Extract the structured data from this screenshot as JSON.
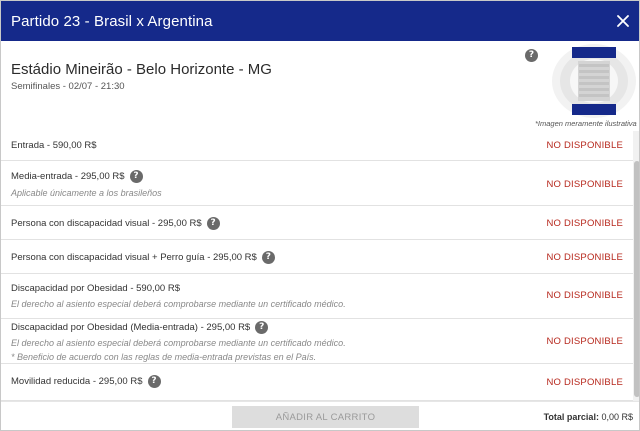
{
  "header": {
    "title": "Partido 23 - Brasil x Argentina"
  },
  "venue": {
    "name": "Estádio Mineirão - Belo Horizonte - MG",
    "date": "Semifinales - 02/07 - 21:30",
    "illustrative_note": "*Imagen meramente ilustrativa"
  },
  "tickets": [
    {
      "label": "Entrada - 590,00 R$",
      "help": false,
      "notes": [],
      "status": "NO DISPONIBLE"
    },
    {
      "label": "Media-entrada - 295,00 R$",
      "help": true,
      "notes": [
        "Aplicable únicamente a los brasileños"
      ],
      "status": "NO DISPONIBLE"
    },
    {
      "label": "Persona con discapacidad visual - 295,00 R$",
      "help": true,
      "notes": [],
      "status": "NO DISPONIBLE"
    },
    {
      "label": "Persona con discapacidad visual + Perro guía - 295,00 R$",
      "help": true,
      "notes": [],
      "status": "NO DISPONIBLE"
    },
    {
      "label": "Discapacidad por Obesidad - 590,00 R$",
      "help": false,
      "notes": [
        "El derecho al asiento especial deberá comprobarse mediante un certificado médico."
      ],
      "status": "NO DISPONIBLE"
    },
    {
      "label": "Discapacidad por Obesidad (Media-entrada) - 295,00 R$",
      "help": true,
      "notes": [
        "El derecho al asiento especial deberá comprobarse mediante un certificado médico.",
        "* Beneficio de acuerdo con las reglas de media-entrada previstas en el País."
      ],
      "status": "NO DISPONIBLE"
    },
    {
      "label": "Movilidad reducida - 295,00 R$",
      "help": true,
      "notes": [],
      "status": "NO DISPONIBLE"
    }
  ],
  "footer": {
    "add_to_cart": "AÑADIR AL CARRITO",
    "total_label": "Total parcial:",
    "total_value": "0,00 R$"
  },
  "icons": {
    "help": "question-mark-icon",
    "close": "close-icon"
  },
  "colors": {
    "header_bg": "#15298a",
    "status_unavailable": "#b7281d",
    "button_disabled_bg": "#dddddd"
  }
}
